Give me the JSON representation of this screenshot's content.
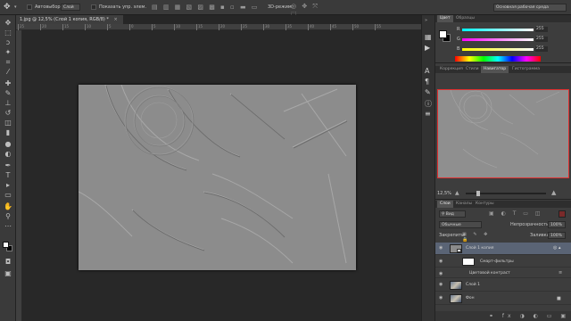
{
  "options_bar": {
    "auto_select_label": "Автовыбор:",
    "auto_select_value": "Слой",
    "show_transform_label": "Показать упр. элем.",
    "mode_3d_label": "3D-режим:",
    "workspace": "Основная рабочая среда"
  },
  "document": {
    "tab_title": "1.jpg @ 12,5% (Слой 1 копия, RGB/8) *"
  },
  "ruler": {
    "ticks": [
      "25",
      "20",
      "15",
      "10",
      "5",
      "0",
      "5",
      "10",
      "15",
      "20",
      "25",
      "30",
      "35",
      "40",
      "45",
      "50",
      "55"
    ]
  },
  "color_panel": {
    "tabs": [
      "Цвет",
      "Образцы"
    ],
    "channels": [
      {
        "label": "R",
        "value": "255",
        "gradient": "linear-gradient(90deg,#00ffff,#ffffff)"
      },
      {
        "label": "G",
        "value": "255",
        "gradient": "linear-gradient(90deg,#ff00ff,#ffffff)"
      },
      {
        "label": "B",
        "value": "255",
        "gradient": "linear-gradient(90deg,#ffff00,#ffffff)"
      }
    ]
  },
  "navigator_panel": {
    "tabs": [
      "Коррекция",
      "Стили",
      "Навигатор",
      "Гистограмма"
    ],
    "zoom": "12,5%",
    "view_box_color": "#e03030"
  },
  "layers_panel": {
    "tabs": [
      "Слои",
      "Каналы",
      "Контуры"
    ],
    "filter_kind": "Вид",
    "blend_mode": "Обычные",
    "opacity_label": "Непрозрачность:",
    "opacity_value": "100%",
    "lock_label": "Закрепить:",
    "fill_label": "Заливка:",
    "fill_value": "100%",
    "layers": [
      {
        "name": "Слой 1 копия",
        "selected": true,
        "visible": true,
        "type": "layer"
      },
      {
        "name": "Смарт-фильтры",
        "selected": false,
        "visible": true,
        "type": "filter-group"
      },
      {
        "name": "Цветовой контраст",
        "selected": false,
        "visible": true,
        "type": "filter"
      },
      {
        "name": "Слой 1",
        "selected": false,
        "visible": true,
        "type": "layer"
      },
      {
        "name": "Фон",
        "selected": false,
        "visible": true,
        "type": "layer-locked"
      }
    ]
  },
  "colors": {
    "selected_layer_bg": "#5a6475",
    "foreground": "#ffffff",
    "background": "#000000"
  }
}
